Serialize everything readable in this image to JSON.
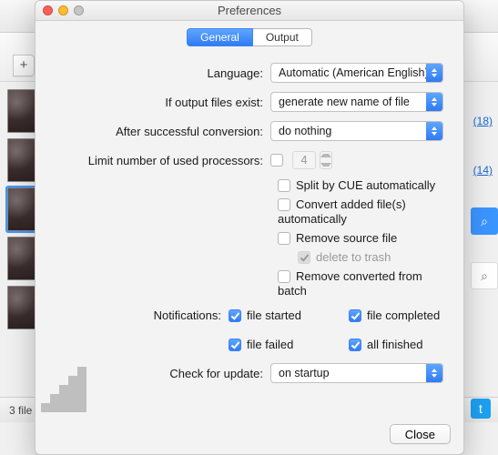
{
  "window": {
    "title": "Preferences"
  },
  "tabs": {
    "general": "General",
    "output": "Output"
  },
  "rows": {
    "language": {
      "label": "Language:",
      "value": "Automatic (American English)"
    },
    "ifExist": {
      "label": "If output files exist:",
      "value": "generate new name of file"
    },
    "afterConv": {
      "label": "After successful conversion:",
      "value": "do nothing"
    },
    "limitProc": {
      "label": "Limit number of used processors:",
      "value": "4"
    },
    "notifications": "Notifications:",
    "checkUpdate": {
      "label": "Check for update:",
      "value": "on startup"
    }
  },
  "opts": {
    "splitCue": "Split by CUE automatically",
    "convertAuto": "Convert added file(s) automatically",
    "removeSource": "Remove source file",
    "deleteTrash": "delete to trash",
    "removeBatch": "Remove converted from batch",
    "fileStarted": "file started",
    "fileCompleted": "file completed",
    "fileFailed": "file failed",
    "allFinished": "all finished"
  },
  "buttons": {
    "close": "Close"
  },
  "background": {
    "status": "3 file",
    "link1": "(18)",
    "link2": "(14)",
    "plus": "+"
  }
}
